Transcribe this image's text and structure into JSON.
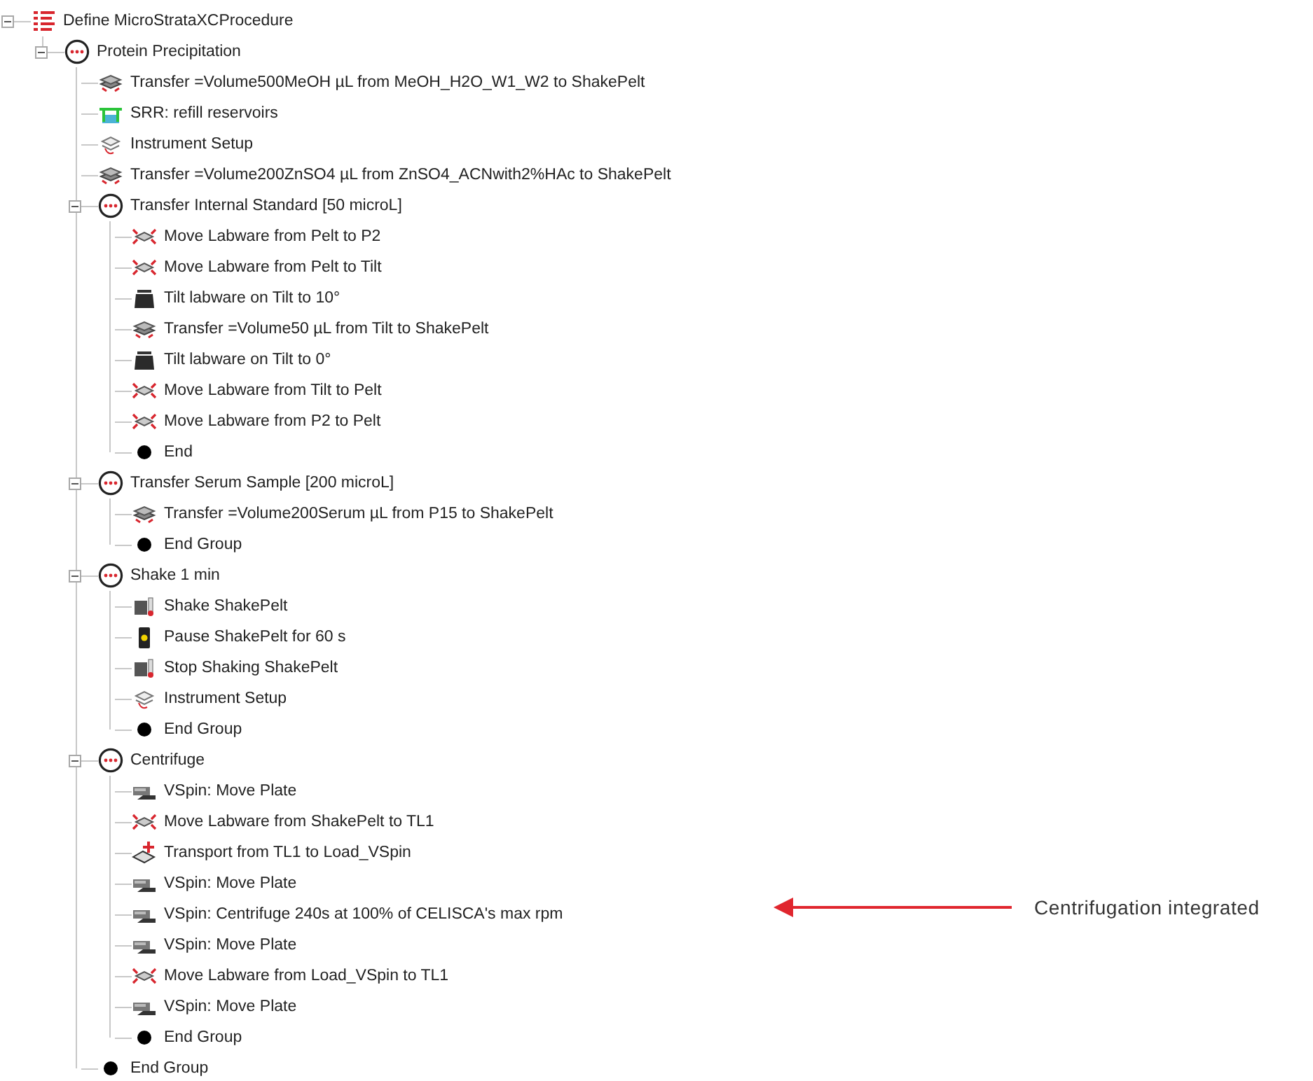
{
  "tree": {
    "label": "Define MicroStrataXCProcedure",
    "kind": "procedure",
    "expanded": true,
    "children": [
      {
        "label": "Protein Precipitation",
        "kind": "group",
        "expanded": true,
        "children": [
          {
            "label": "Transfer =Volume500MeOH µL from MeOH_H2O_W1_W2 to ShakePelt",
            "kind": "transfer"
          },
          {
            "label": "SRR: refill reservoirs",
            "kind": "srr"
          },
          {
            "label": "Instrument Setup",
            "kind": "setup"
          },
          {
            "label": "Transfer =Volume200ZnSO4 µL from ZnSO4_ACNwith2%HAc to ShakePelt",
            "kind": "transfer"
          },
          {
            "label": "Transfer Internal Standard [50 microL]",
            "kind": "group",
            "expanded": true,
            "children": [
              {
                "label": "Move Labware from Pelt to P2",
                "kind": "move"
              },
              {
                "label": "Move Labware from Pelt to Tilt",
                "kind": "move"
              },
              {
                "label": "Tilt labware on Tilt to 10°",
                "kind": "tilt"
              },
              {
                "label": "Transfer =Volume50 µL from Tilt to ShakePelt",
                "kind": "transfer"
              },
              {
                "label": "Tilt labware on Tilt to 0°",
                "kind": "tilt"
              },
              {
                "label": "Move Labware from Tilt to Pelt",
                "kind": "move"
              },
              {
                "label": "Move Labware from P2 to Pelt",
                "kind": "move"
              },
              {
                "label": "End",
                "kind": "end"
              }
            ]
          },
          {
            "label": "Transfer Serum Sample [200 microL]",
            "kind": "group",
            "expanded": true,
            "children": [
              {
                "label": "Transfer =Volume200Serum µL from P15 to ShakePelt",
                "kind": "transfer"
              },
              {
                "label": "End Group",
                "kind": "end"
              }
            ]
          },
          {
            "label": "Shake 1 min",
            "kind": "group",
            "expanded": true,
            "children": [
              {
                "label": "Shake ShakePelt",
                "kind": "shake"
              },
              {
                "label": "Pause ShakePelt for 60 s",
                "kind": "pause"
              },
              {
                "label": "Stop Shaking ShakePelt",
                "kind": "shake"
              },
              {
                "label": "Instrument Setup",
                "kind": "setup"
              },
              {
                "label": "End Group",
                "kind": "end"
              }
            ]
          },
          {
            "label": "Centrifuge",
            "kind": "group",
            "expanded": true,
            "children": [
              {
                "label": "VSpin: Move Plate",
                "kind": "vspin"
              },
              {
                "label": "Move Labware from ShakePelt to TL1",
                "kind": "move"
              },
              {
                "label": "Transport from TL1 to Load_VSpin",
                "kind": "transport"
              },
              {
                "label": "VSpin: Move Plate",
                "kind": "vspin"
              },
              {
                "label": "VSpin: Centrifuge 240s at 100% of CELISCA's max rpm",
                "kind": "vspin"
              },
              {
                "label": "VSpin: Move Plate",
                "kind": "vspin"
              },
              {
                "label": "Move Labware from Load_VSpin to TL1",
                "kind": "move"
              },
              {
                "label": "VSpin: Move Plate",
                "kind": "vspin"
              },
              {
                "label": "End Group",
                "kind": "end"
              }
            ]
          },
          {
            "label": "End Group",
            "kind": "end"
          }
        ]
      }
    ]
  },
  "annotation": {
    "label": "Centrifugation integrated"
  }
}
